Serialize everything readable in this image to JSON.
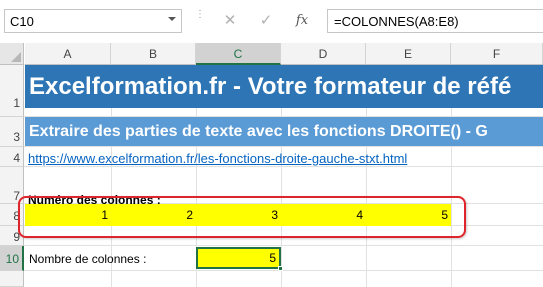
{
  "formula_bar": {
    "name_box": "C10",
    "cancel_icon": "✕",
    "enter_icon": "✓",
    "fx_icon": "fx",
    "formula": "=COLONNES(A8:E8)"
  },
  "columns": [
    "A",
    "B",
    "C",
    "D",
    "E",
    "F"
  ],
  "selected_column": "C",
  "rows": [
    "1",
    "3",
    "4",
    "7",
    "8",
    "9",
    "10"
  ],
  "selected_row": "10",
  "cells": {
    "row1": "Excelformation.fr - Votre formateur de réfé",
    "row3": "Extraire des parties de texte avec les fonctions DROITE() - G",
    "row4_link": "https://www.excelformation.fr/les-fonctions-droite-gauche-stxt.html",
    "row7": "Numéro des colonnes :",
    "row8": [
      "1",
      "2",
      "3",
      "4",
      "5"
    ],
    "row10_label": "Nombre de colonnes :",
    "c10": "5"
  },
  "colors": {
    "banner_dark": "#2e75b6",
    "banner_light": "#5b9bd5",
    "highlight": "#ffff00",
    "callout_border": "#e0242b",
    "selection": "#217346",
    "link": "#0563c1"
  }
}
